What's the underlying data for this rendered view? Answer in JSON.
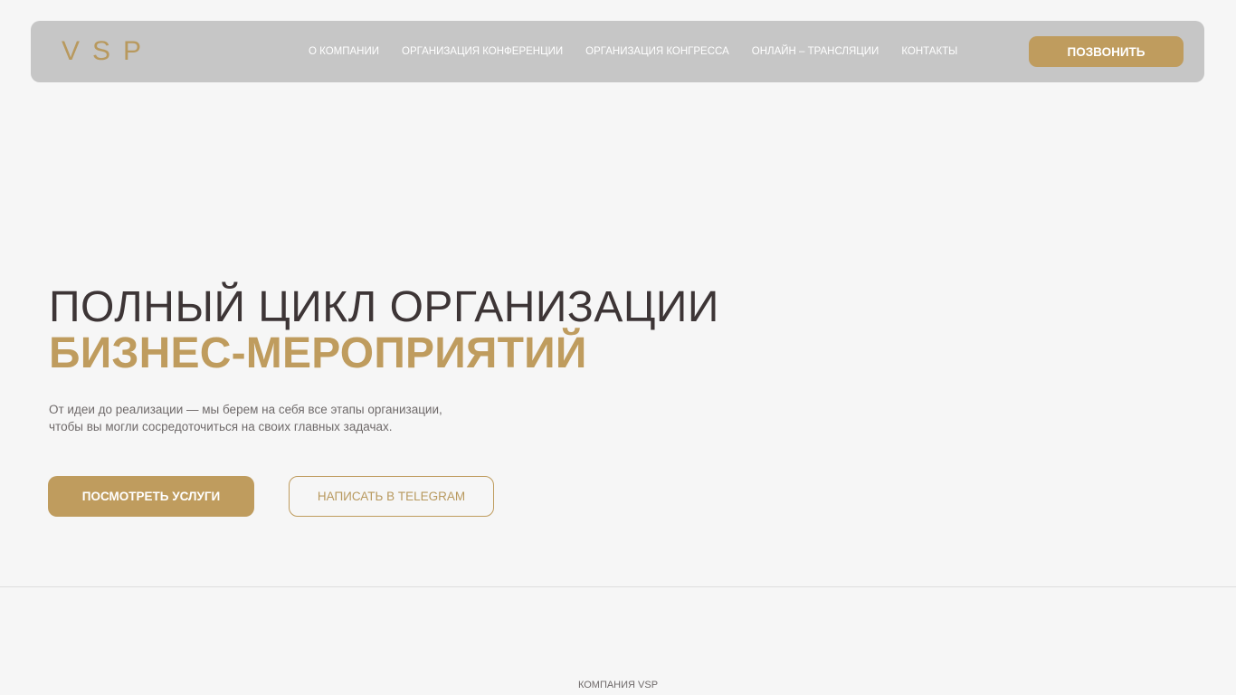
{
  "header": {
    "logo": "VSP",
    "nav": [
      {
        "label": "О КОМПАНИИ"
      },
      {
        "label": "ОРГАНИЗАЦИЯ КОНФЕРЕНЦИИ"
      },
      {
        "label": "ОРГАНИЗАЦИЯ КОНГРЕССА"
      },
      {
        "label": "ОНЛАЙН – ТРАНСЛЯЦИИ"
      },
      {
        "label": "КОНТАКТЫ"
      }
    ],
    "call_button": "ПОЗВОНИТЬ"
  },
  "hero": {
    "title_line1": "ПОЛНЫЙ ЦИКЛ ОРГАНИЗАЦИИ",
    "title_line2": "БИЗНЕС-МЕРОПРИЯТИЙ",
    "subtitle_line1": "От идеи до реализации — мы берем на себя все этапы организации,",
    "subtitle_line2": "чтобы вы могли сосредоточиться на своих главных задачах.",
    "primary_button": "ПОСМОТРЕТЬ УСЛУГИ",
    "secondary_button": "НАПИСАТЬ В TELEGRAM"
  },
  "section": {
    "label": "КОМПАНИЯ VSP"
  },
  "colors": {
    "accent": "#bf9c5e",
    "header_bg": "#c6c6c6",
    "page_bg": "#f6f6f6",
    "heading_dark": "#3d3536"
  }
}
